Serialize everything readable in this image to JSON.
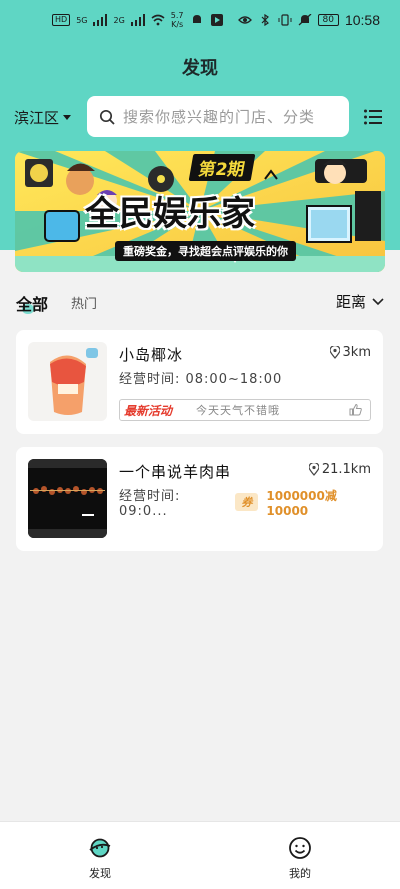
{
  "status_bar": {
    "sim1": "HD",
    "sim2": "5G",
    "sim3": "2G",
    "speed_value": "5.7",
    "speed_unit": "K/s",
    "battery": "80",
    "time": "10:58"
  },
  "header": {
    "title": "发现",
    "district": "滨江区",
    "search_placeholder": "搜索你感兴趣的门店、分类"
  },
  "banner": {
    "issue": "第2期",
    "title": "全民娱乐家",
    "subtitle": "重磅奖金，寻找超会点评娱乐的你"
  },
  "tabs": {
    "all": "全部",
    "hot": "热门",
    "sort": "距离"
  },
  "shops": [
    {
      "name": "小岛椰冰",
      "distance": "3km",
      "hours": "经营时间: 08:00~18:00",
      "activity_tag": "最新活动",
      "activity_text": "今天天气不错哦"
    },
    {
      "name": "一个串说羊肉串",
      "distance": "21.1km",
      "hours": "经营时间: 09:0...",
      "coupon_badge": "券",
      "coupon_text": "1000000减10000"
    }
  ],
  "bottom_nav": {
    "discover": "发现",
    "mine": "我的"
  },
  "colors": {
    "accent": "#5fd6c4",
    "activity_red": "#e53c2e",
    "coupon_orange": "#e0902a"
  }
}
